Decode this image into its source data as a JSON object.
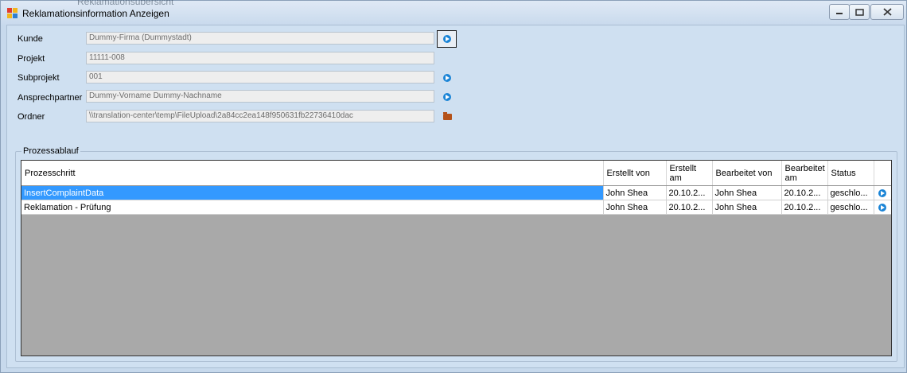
{
  "window": {
    "title": "Reklamationsinformation Anzeigen",
    "background_title": "Reklamationsübersicht"
  },
  "form": {
    "kunde": {
      "label": "Kunde",
      "value": "Dummy-Firma (Dummystadt)"
    },
    "projekt": {
      "label": "Projekt",
      "value": "11111-008"
    },
    "subprojekt": {
      "label": "Subprojekt",
      "value": "001"
    },
    "ansprechpartner": {
      "label": "Ansprechpartner",
      "value": "Dummy-Vorname Dummy-Nachname"
    },
    "ordner": {
      "label": "Ordner",
      "value": "\\\\translation-center\\temp\\FileUpload\\2a84cc2ea148f950631fb22736410dac"
    }
  },
  "group": {
    "title": "Prozessablauf"
  },
  "grid": {
    "columns": [
      "Prozesschritt",
      "Erstellt von",
      "Erstellt am",
      "Bearbeitet von",
      "Bearbeitet am",
      "Status"
    ],
    "rows": [
      {
        "schritt": "InsertComplaintData",
        "erstellt_von": "John Shea",
        "erstellt_am": "20.10.2...",
        "bearbeitet_von": "John Shea",
        "bearbeitet_am": "20.10.2...",
        "status": "geschlo...",
        "selected": true
      },
      {
        "schritt": "Reklamation - Prüfung",
        "erstellt_von": "John Shea",
        "erstellt_am": "20.10.2...",
        "bearbeitet_von": "John Shea",
        "bearbeitet_am": "20.10.2...",
        "status": "geschlo...",
        "selected": false
      }
    ]
  },
  "icons": {
    "go": "arrow-circle-icon",
    "folder": "folder-icon",
    "app": "app-icon"
  },
  "colors": {
    "selection": "#3399ff",
    "go_icon": "#1a84d6",
    "folder": "#b4521a"
  }
}
